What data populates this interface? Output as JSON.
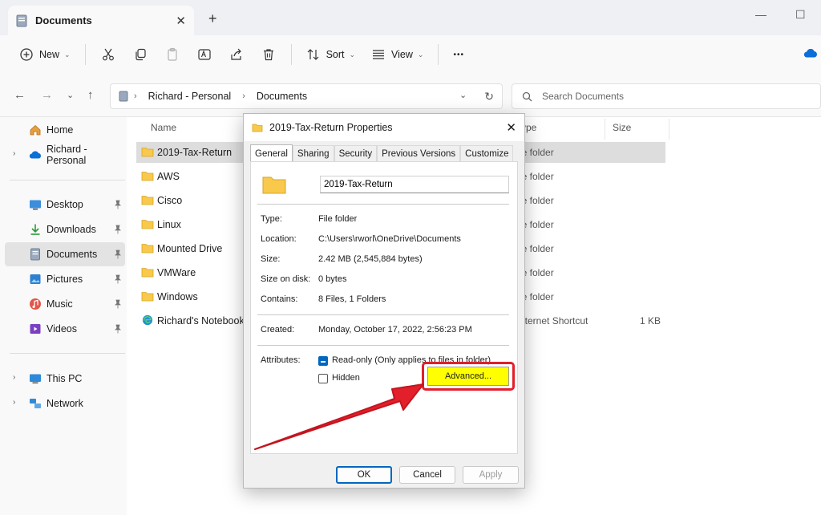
{
  "window": {
    "tab_title": "Documents",
    "new_tab_symbol": "+",
    "close_symbol": "✕",
    "minimize_symbol": "—",
    "maximize_symbol": "☐"
  },
  "toolbar": {
    "new_label": "New",
    "sort_label": "Sort",
    "view_label": "View",
    "more_symbol": "•••"
  },
  "address": {
    "crumbs": [
      "Richard - Personal",
      "Documents"
    ],
    "search_placeholder": "Search Documents"
  },
  "sidebar": {
    "items": [
      {
        "label": "Home",
        "icon": "home-icon"
      },
      {
        "label": "Richard - Personal",
        "icon": "onedrive-cloud-icon"
      },
      {
        "label": "Desktop",
        "icon": "desktop-icon"
      },
      {
        "label": "Downloads",
        "icon": "download-icon"
      },
      {
        "label": "Documents",
        "icon": "documents-icon"
      },
      {
        "label": "Pictures",
        "icon": "pictures-icon"
      },
      {
        "label": "Music",
        "icon": "music-icon"
      },
      {
        "label": "Videos",
        "icon": "videos-icon"
      },
      {
        "label": "This PC",
        "icon": "pc-icon"
      },
      {
        "label": "Network",
        "icon": "network-icon"
      }
    ]
  },
  "columns": {
    "name": "Name",
    "type": "ype",
    "size": "Size"
  },
  "files": [
    {
      "name": "2019-Tax-Return",
      "type": "le folder",
      "size": ""
    },
    {
      "name": "AWS",
      "type": "le folder",
      "size": ""
    },
    {
      "name": "Cisco",
      "type": "le folder",
      "size": ""
    },
    {
      "name": "Linux",
      "type": "le folder",
      "size": ""
    },
    {
      "name": "Mounted Drive",
      "type": "le folder",
      "size": ""
    },
    {
      "name": "VMWare",
      "type": "le folder",
      "size": ""
    },
    {
      "name": "Windows",
      "type": "le folder",
      "size": ""
    },
    {
      "name": "Richard's Notebook",
      "type": "nternet Shortcut",
      "size": "1 KB"
    }
  ],
  "dialog": {
    "title": "2019-Tax-Return Properties",
    "tabs": [
      "General",
      "Sharing",
      "Security",
      "Previous Versions",
      "Customize"
    ],
    "name_value": "2019-Tax-Return",
    "type_label": "Type:",
    "type_value": "File folder",
    "location_label": "Location:",
    "location_value": "C:\\Users\\rworl\\OneDrive\\Documents",
    "size_label": "Size:",
    "size_value": "2.42 MB (2,545,884 bytes)",
    "size_on_disk_label": "Size on disk:",
    "size_on_disk_value": "0 bytes",
    "contains_label": "Contains:",
    "contains_value": "8 Files, 1 Folders",
    "created_label": "Created:",
    "created_value": "Monday, October 17, 2022, 2:56:23 PM",
    "attributes_label": "Attributes:",
    "readonly_label": "Read-only (Only applies to files in folder)",
    "hidden_label": "Hidden",
    "advanced_label": "Advanced...",
    "ok_label": "OK",
    "cancel_label": "Cancel",
    "apply_label": "Apply"
  },
  "colors": {
    "folder": "#f8c94a",
    "accent": "#0067c0",
    "highlight": "#ffff00",
    "annotation_red": "#e21f2a"
  }
}
